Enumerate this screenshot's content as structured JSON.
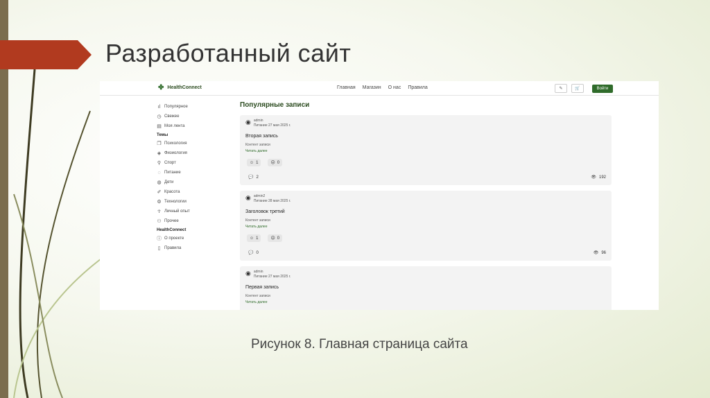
{
  "slide": {
    "title": "Разработанный сайт",
    "caption": "Рисунок 8. Главная страница сайта"
  },
  "site": {
    "logo": "HealthConnect",
    "nav": [
      "Главная",
      "Магазин",
      "О нас",
      "Правила"
    ],
    "header_icons": [
      "bookmark-icon",
      "cart-icon"
    ],
    "login_label": "Войти",
    "sidebar": {
      "top_items": [
        {
          "icon": "chart-icon",
          "label": "Популярное"
        },
        {
          "icon": "clock-icon",
          "label": "Свежее"
        },
        {
          "icon": "feed-icon",
          "label": "Моя лента"
        }
      ],
      "topics_heading": "Темы",
      "topics": [
        {
          "icon": "copy-icon",
          "label": "Психология"
        },
        {
          "icon": "diamond-icon",
          "label": "Физиология"
        },
        {
          "icon": "bike-icon",
          "label": "Спорт"
        },
        {
          "icon": "apple-icon",
          "label": "Питание"
        },
        {
          "icon": "globe-icon",
          "label": "Дети"
        },
        {
          "icon": "brush-icon",
          "label": "Красота"
        },
        {
          "icon": "tech-icon",
          "label": "Технологии"
        },
        {
          "icon": "person-icon",
          "label": "Личный опыт"
        },
        {
          "icon": "people-icon",
          "label": "Прочее"
        }
      ],
      "section_heading": "HealthConnect",
      "section_items": [
        {
          "icon": "info-icon",
          "label": "О проекте"
        },
        {
          "icon": "book-icon",
          "label": "Правила"
        }
      ]
    },
    "main_title": "Популярные записи",
    "posts": [
      {
        "author": "admin",
        "meta": "Питание 27 мая 2025 г.",
        "title": "Вторая запись",
        "content": "Контент записи",
        "more": "Читать далее",
        "likes": "1",
        "dislikes": "0",
        "comments": "2",
        "views": "192"
      },
      {
        "author": "admin2",
        "meta": "Питание 28 мая 2025 г.",
        "title": "Заголовок третий",
        "content": "Контент записи",
        "more": "Читать далее",
        "likes": "1",
        "dislikes": "0",
        "comments": "0",
        "views": "96"
      },
      {
        "author": "admin",
        "meta": "Питание 27 мая 2025 г.",
        "title": "Первая запись",
        "content": "Контент записи",
        "more": "Читать далее"
      }
    ]
  },
  "colors": {
    "accent_red": "#b13a1f",
    "brand_green": "#2f6b2a",
    "stripe": "#7b6d4e"
  }
}
